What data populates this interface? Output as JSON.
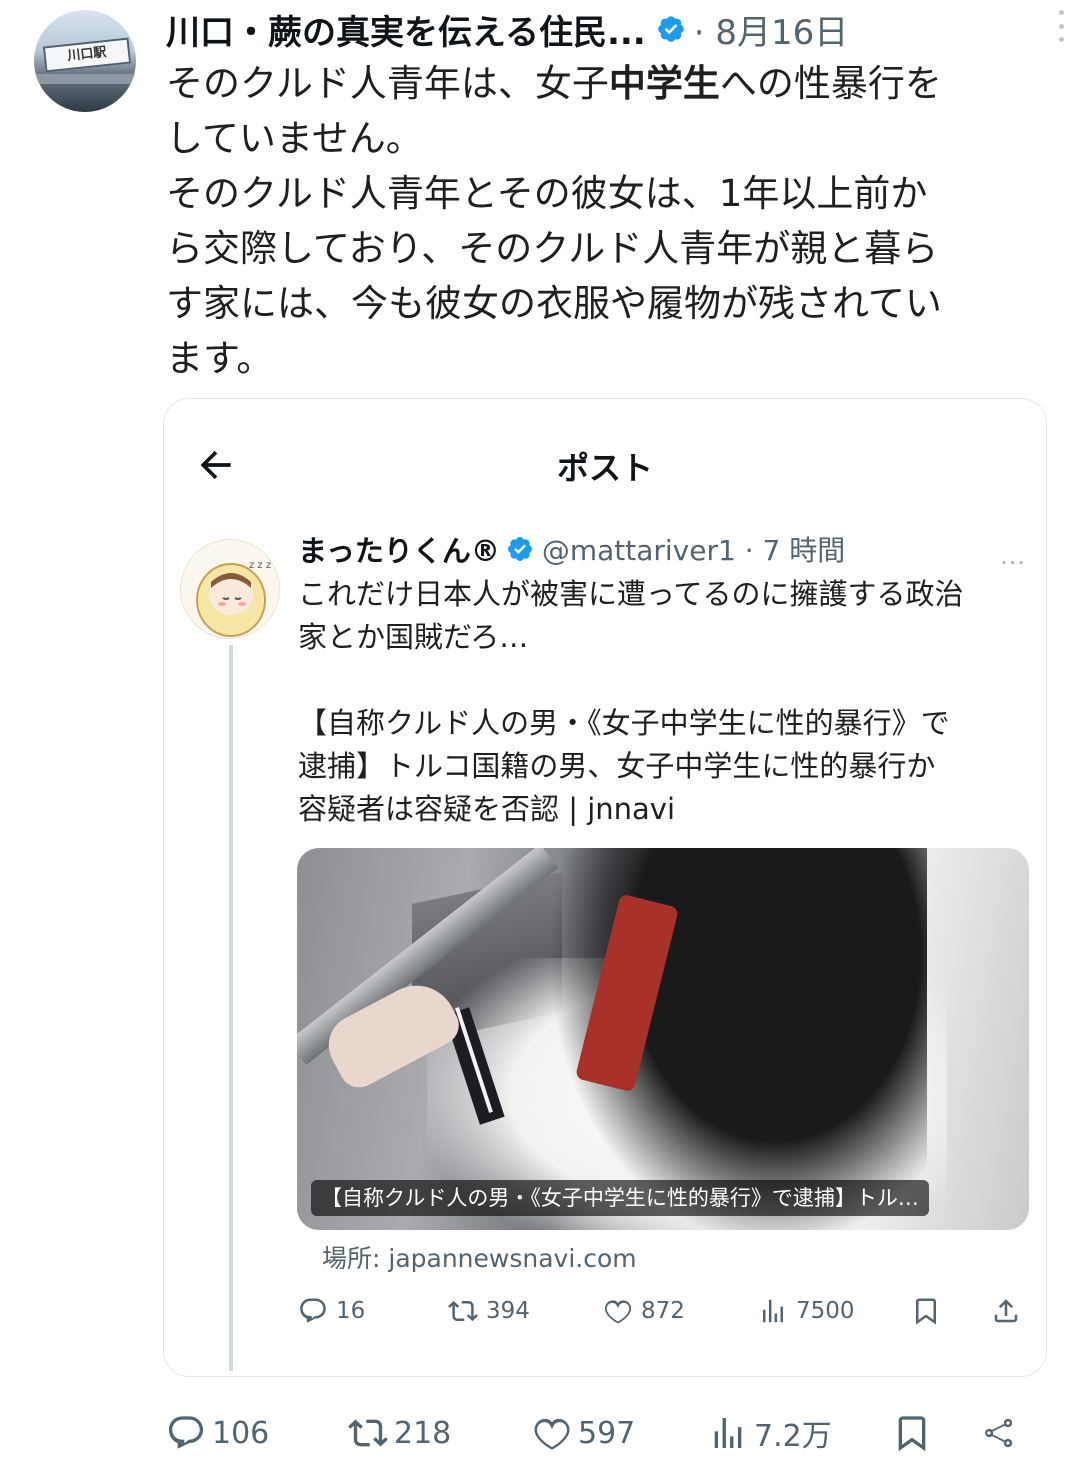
{
  "author": {
    "display_name": "川口・蕨の真実を伝える住民...",
    "date": "· 8月16日",
    "avatar_sign": "川口駅"
  },
  "tweet": {
    "lines": [
      {
        "pre": "そのクルド人青年は、女子",
        "bold": "中学生",
        "post": "への性暴行を"
      },
      {
        "text": "していません。"
      },
      {
        "text": "そのクルド人青年とその彼女は、1年以上前か"
      },
      {
        "text": "ら交際しており、そのクルド人青年が親と暮ら"
      },
      {
        "text": "す家には、今も彼女の衣服や履物が残されてい"
      },
      {
        "text": "ます。"
      }
    ]
  },
  "quote": {
    "header_title": "ポスト",
    "author": {
      "display_name": "まったりくん®",
      "handle_time": "@mattariver1 · 7 時間"
    },
    "more": "···",
    "text_lines": [
      "これだけ日本人が被害に遭ってるのに擁護する政治",
      "家とか国賊だろ…",
      "",
      "【自称クルド人の男・《女子中学生に性的暴行》で",
      "逮捕】トルコ国籍の男、女子中学生に性的暴行か",
      "容疑者は容疑を否認 | jnnavi"
    ],
    "media_caption": "【自称クルド人の男・《女子中学生に性的暴行》で逮捕】トル…",
    "source": "場所: japannewsnavi.com",
    "actions": {
      "replies": "16",
      "reposts": "394",
      "likes": "872",
      "views": "7500"
    }
  },
  "actions": {
    "replies": "106",
    "reposts": "218",
    "likes": "597",
    "views": "7.2万"
  },
  "colors": {
    "text": "#0f1419",
    "muted": "#536471",
    "verified": "#1d9bf0",
    "border": "#e3e7ea"
  }
}
